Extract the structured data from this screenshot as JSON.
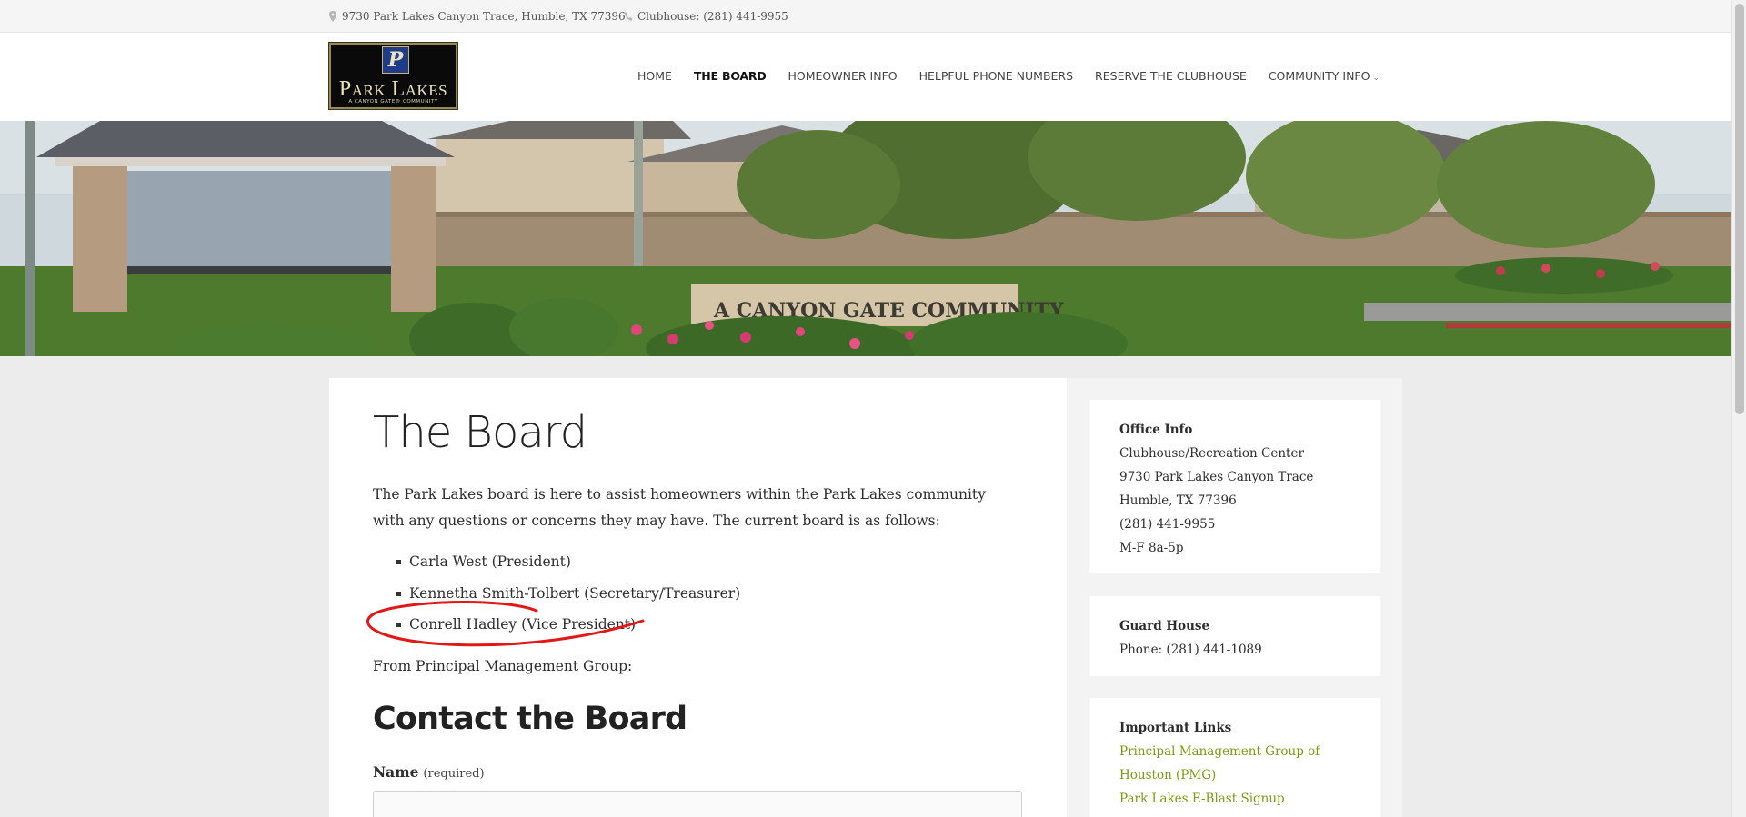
{
  "topbar": {
    "address": "9730 Park Lakes Canyon Trace, Humble, TX 77396",
    "phone": "Clubhouse: (281) 441-9955"
  },
  "logo": {
    "monogram": "P",
    "name": "Park Lakes",
    "tagline": "A CANYON GATE® COMMUNITY"
  },
  "nav": {
    "items": [
      {
        "label": "HOME"
      },
      {
        "label": "THE BOARD",
        "active": true
      },
      {
        "label": "HOMEOWNER INFO"
      },
      {
        "label": "HELPFUL PHONE NUMBERS"
      },
      {
        "label": "RESERVE THE CLUBHOUSE"
      },
      {
        "label": "COMMUNITY INFO",
        "dropdown": true
      }
    ]
  },
  "banner": {
    "sign_text": "A CANYON GATE COMMUNITY"
  },
  "main": {
    "title": "The Board",
    "intro": "The Park Lakes board is here to assist homeowners within the Park Lakes community with any questions or concerns they may have. The current board is as follows:",
    "board_members": [
      "Carla West (President)",
      "Kennetha Smith-Tolbert (Secretary/Treasurer)",
      "Conrell Hadley (Vice President)"
    ],
    "pmg_text": "From Principal Management Group:",
    "contact_title": "Contact the Board",
    "name_label": "Name",
    "name_required": "(required)",
    "name_value": ""
  },
  "sidebar": {
    "office": {
      "title": "Office Info",
      "lines": [
        "Clubhouse/Recreation Center",
        "9730 Park Lakes Canyon Trace",
        "Humble, TX 77396",
        "(281) 441-9955",
        "M-F 8a-5p"
      ]
    },
    "guard": {
      "title": "Guard House",
      "phone": "Phone: (281) 441-1089"
    },
    "links": {
      "title": "Important Links",
      "items": [
        "Principal Management Group of Houston (PMG)",
        "Park Lakes E-Blast Signup"
      ]
    }
  },
  "colors": {
    "link": "#7a9a0e",
    "highlight_circle": "#e01818",
    "content_bg": "#ffffff",
    "page_bg": "#ececec"
  }
}
